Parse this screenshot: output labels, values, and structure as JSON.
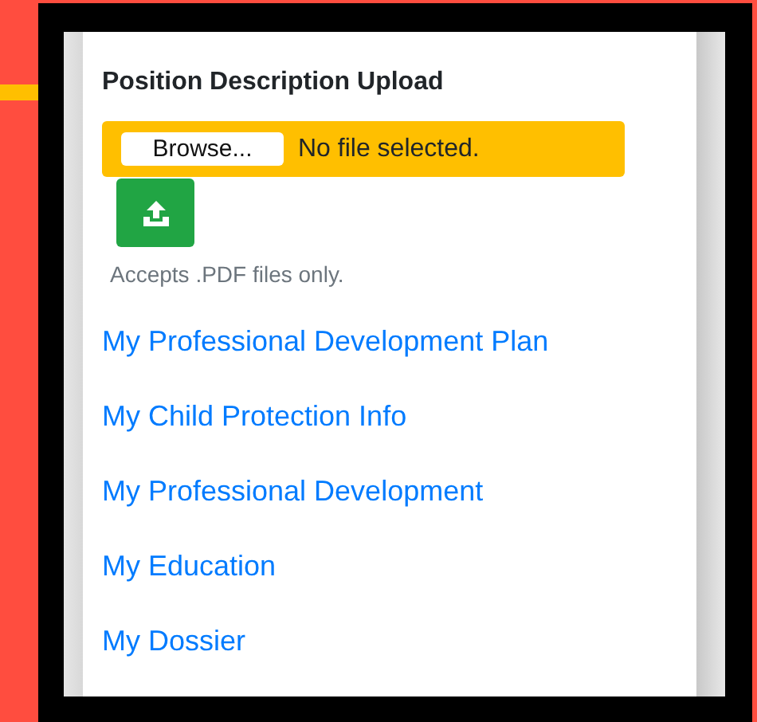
{
  "section": {
    "title": "Position Description Upload"
  },
  "file_input": {
    "button_label": "Browse...",
    "status": "No file selected."
  },
  "upload_hint": "Accepts .PDF files only.",
  "links": [
    "My Professional Development Plan",
    "My Child Protection Info",
    "My Professional Development",
    "My Education",
    "My Dossier"
  ]
}
